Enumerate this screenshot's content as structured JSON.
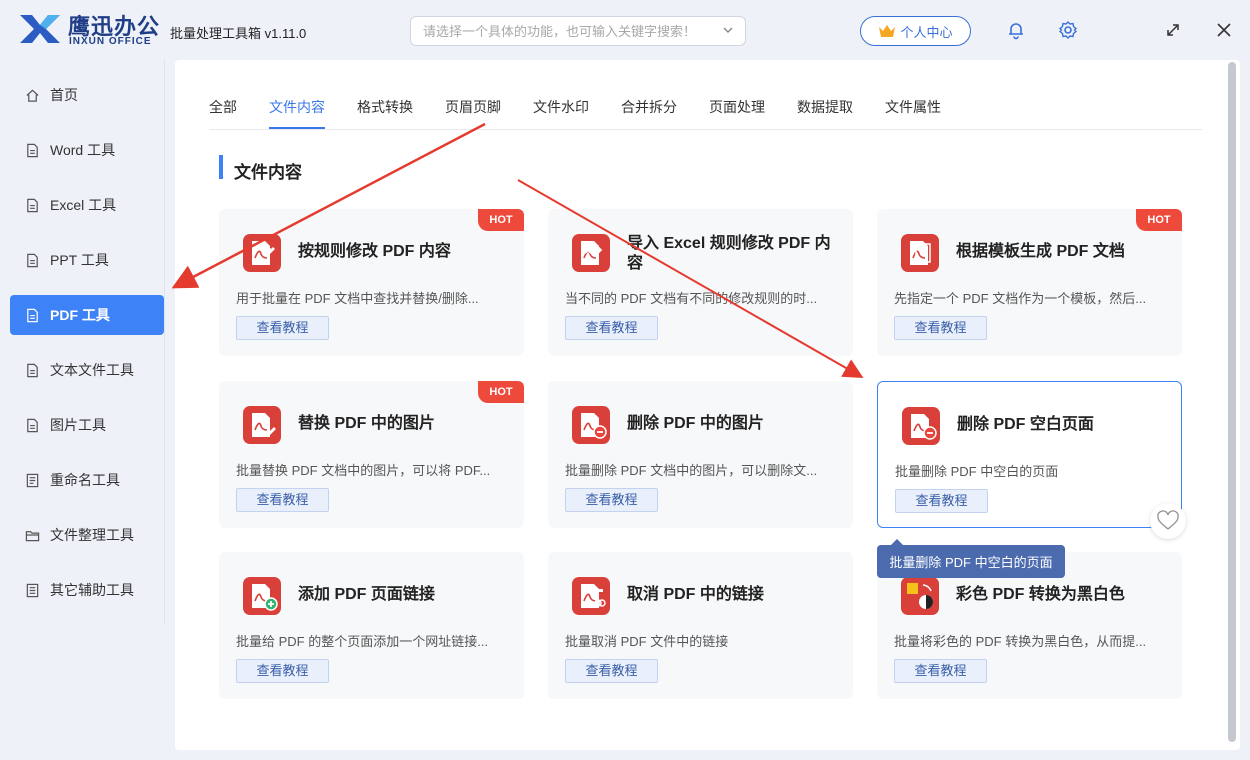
{
  "app": {
    "brand_cn": "鹰迅办公",
    "brand_en": "INXUN OFFICE",
    "title": "批量处理工具箱 v1.11.0",
    "search_placeholder": "请选择一个具体的功能，也可输入关键字搜索！",
    "user_center": "个人中心"
  },
  "sidebar": {
    "items": [
      {
        "label": "首页",
        "icon": "home-icon"
      },
      {
        "label": "Word 工具",
        "icon": "word-file-icon"
      },
      {
        "label": "Excel 工具",
        "icon": "excel-file-icon"
      },
      {
        "label": "PPT 工具",
        "icon": "ppt-file-icon"
      },
      {
        "label": "PDF 工具",
        "icon": "pdf-file-icon",
        "active": true
      },
      {
        "label": "文本文件工具",
        "icon": "text-file-icon"
      },
      {
        "label": "图片工具",
        "icon": "image-file-icon"
      },
      {
        "label": "重命名工具",
        "icon": "rename-icon"
      },
      {
        "label": "文件整理工具",
        "icon": "folder-icon"
      },
      {
        "label": "其它辅助工具",
        "icon": "tools-icon"
      }
    ]
  },
  "tabs": [
    "全部",
    "文件内容",
    "格式转换",
    "页眉页脚",
    "文件水印",
    "合并拆分",
    "页面处理",
    "数据提取",
    "文件属性"
  ],
  "active_tab": "文件内容",
  "section_title": "文件内容",
  "cards": [
    {
      "title": "按规则修改 PDF 内容",
      "desc": "用于批量在 PDF 文档中查找并替换/删除...",
      "button": "查看教程",
      "badge": "HOT",
      "icon": "pdf-edit-icon"
    },
    {
      "title": "导入 Excel 规则修改 PDF 内容",
      "desc": "当不同的 PDF 文档有不同的修改规则的时...",
      "button": "查看教程",
      "icon": "excel-import-icon"
    },
    {
      "title": "根据模板生成 PDF 文档",
      "desc": "先指定一个 PDF 文档作为一个模板，然后...",
      "button": "查看教程",
      "badge": "HOT",
      "icon": "pdf-template-icon"
    },
    {
      "title": "替换 PDF 中的图片",
      "desc": "批量替换 PDF 文档中的图片，可以将 PDF...",
      "button": "查看教程",
      "badge": "HOT",
      "icon": "pdf-replace-image-icon"
    },
    {
      "title": "删除 PDF 中的图片",
      "desc": "批量删除 PDF 文档中的图片，可以删除文...",
      "button": "查看教程",
      "icon": "pdf-delete-image-icon"
    },
    {
      "title": "删除 PDF 空白页面",
      "desc": "批量删除 PDF 中空白的页面",
      "button": "查看教程",
      "icon": "pdf-delete-page-icon",
      "selected": true
    },
    {
      "title": "添加 PDF 页面链接",
      "desc": "批量给 PDF 的整个页面添加一个网址链接...",
      "button": "查看教程",
      "icon": "pdf-add-link-icon"
    },
    {
      "title": "取消 PDF 中的链接",
      "desc": "批量取消 PDF 文件中的链接",
      "button": "查看教程",
      "icon": "pdf-remove-link-icon"
    },
    {
      "title": "彩色 PDF 转换为黑白色",
      "desc": "批量将彩色的 PDF 转换为黑白色，从而提...",
      "button": "查看教程",
      "icon": "pdf-grayscale-icon"
    }
  ],
  "tooltip": "批量删除 PDF 中空白的页面",
  "colors": {
    "accent": "#3e82f7",
    "hot": "#ee4a3c",
    "icon_red": "#d9403a",
    "annotation_arrow": "#e53a2e"
  }
}
